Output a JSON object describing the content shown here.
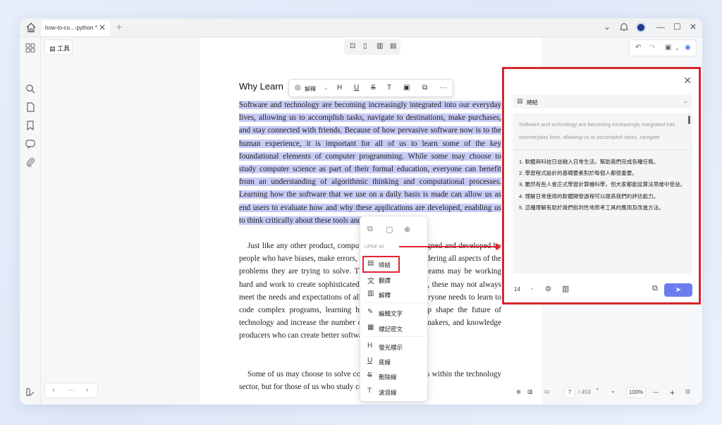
{
  "tab": {
    "title": "how-to-co...-python *",
    "close": "✕",
    "add": "+"
  },
  "window_controls": {
    "chevron": "⌄",
    "bell": "🔔",
    "minimize": "—",
    "maximize": "☐",
    "close": "✕"
  },
  "tools_label": "工具",
  "left_nav": {
    "prev": "‹",
    "dots": "···",
    "next": "›"
  },
  "document": {
    "title": "Why Learn",
    "paragraph1": "Software and technology are becoming increasingly integrated into our everyday lives, allowing us to accomplish tasks, navigate to destinations, make purchases, and stay connected with friends. Because of how pervasive software now is to the human experience, it is important for all of us to learn some of the key foundational elements of computer programming. While some may choose to study computer science as part of their formal education, everyone can benefit from an understanding of algorithmic thinking and computational processes. Learning how the software that we use on a daily basis is made can allow us as end users to evaluate how and why these applications are developed, enabling us to think critically about these tools and how we use them.",
    "paragraph2": "Just like any other product, computer programs are designed and developed by people who have biases, make errors, and may not be considering all aspects of the problems they are trying to solve. Though development teams may be working hard and work to create sophisticated and useful programs, these may not always meet the needs and expectations of all users. While not everyone needs to learn to code complex programs, learning how to code can help shape the future of technology and increase the number of creators, decision makers, and knowledge producers who can create better software for everyone.",
    "paragraph3": "Some of us may choose to solve computational problems within the technology sector, but for those of us who study computer science, a"
  },
  "float_toolbar": {
    "ai_label": "解釋",
    "more": "···"
  },
  "context_menu": {
    "section": "UPDF AI",
    "items": [
      {
        "icon": "▤",
        "label": "總結"
      },
      {
        "icon": "文",
        "label": "翻譯"
      },
      {
        "icon": "▥",
        "label": "解釋"
      },
      {
        "icon": "✎",
        "label": "編輯文字"
      },
      {
        "icon": "▦",
        "label": "標記密文"
      },
      {
        "icon": "H",
        "label": "螢光標示"
      },
      {
        "icon": "U",
        "label": "底線"
      },
      {
        "icon": "S",
        "label": "刪除線"
      },
      {
        "icon": "T",
        "label": "波浪線"
      }
    ]
  },
  "ai_panel": {
    "mode": "總結",
    "source_text": "Software and technology are becoming increasingly integrated into oureveryday lives, allowing us to accomplish tasks, navigate",
    "summary": [
      "1. 軟體與科技日益融入日常生活，幫助我們完成各種任務。",
      "2. 學習程式設計的基礎要素對於每個人都很重要。",
      "3. 雖然有些人會正式學習計算機科學，但大家都能從算法思維中受益。",
      "4. 理解日常使用的軟體開發過程可以提高我們的評估能力。",
      "5. 這種理解有助於我們批判性地思考工具的應用及改進方法。"
    ],
    "font_size": "14",
    "send": "➤"
  },
  "status": {
    "page": "7",
    "total": "/ 459",
    "zoom": "100%",
    "minus": "—",
    "plus": "+"
  },
  "colors": {
    "highlight": "#c7cbf5",
    "callout": "#e0262f",
    "send": "#6b7ef0"
  }
}
